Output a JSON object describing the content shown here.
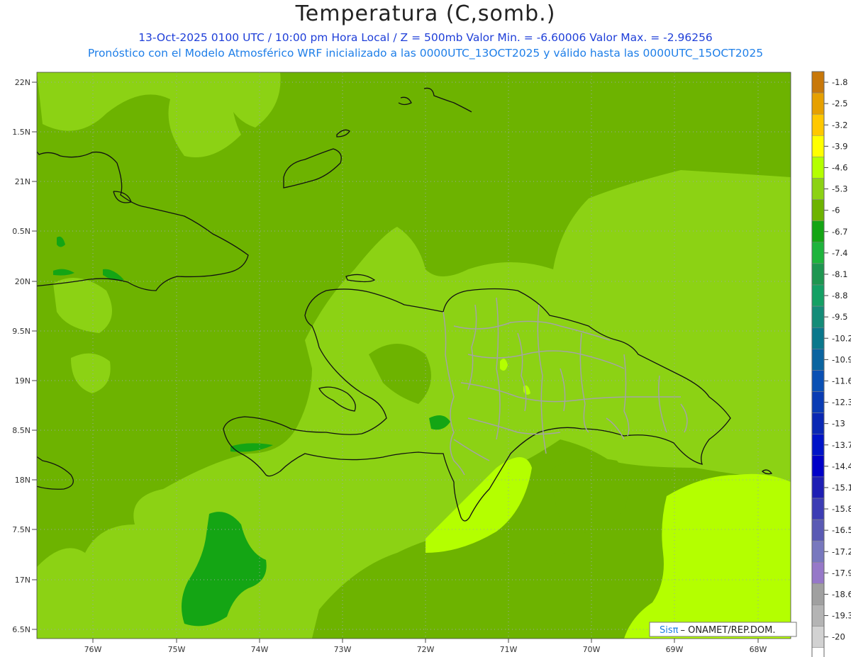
{
  "header": {
    "title": "Temperatura (C,somb.)",
    "subtitle_1": "13-Oct-2025  0100 UTC / 10:00 pm Hora Local / Z = 500mb  Valor Min. = -6.60006  Valor Max. = -2.96256",
    "subtitle_2": "Pronóstico con el Modelo Atmosférico WRF inicializado a las 0000UTC_13OCT2025 y válido hasta las  0000UTC_15OCT2025"
  },
  "map": {
    "lat_labels": [
      "22N",
      "1.5N",
      "21N",
      "0.5N",
      "20N",
      "9.5N",
      "19N",
      "8.5N",
      "18N",
      "7.5N",
      "17N",
      "6.5N"
    ],
    "lon_labels": [
      "76W",
      "75W",
      "74W",
      "73W",
      "72W",
      "71W",
      "70W",
      "69W",
      "68W"
    ],
    "background_color": "#6db300",
    "grid": "dotted"
  },
  "colorbar": {
    "entries": [
      {
        "label": "-1.8",
        "color": "#c8780a"
      },
      {
        "label": "-2.5",
        "color": "#e6a000"
      },
      {
        "label": "-3.2",
        "color": "#ffc800"
      },
      {
        "label": "-3.9",
        "color": "#ffff00"
      },
      {
        "label": "-4.6",
        "color": "#b4ff00"
      },
      {
        "label": "-5.3",
        "color": "#8cd214"
      },
      {
        "label": "-6",
        "color": "#6db300"
      },
      {
        "label": "-6.7",
        "color": "#14a514"
      },
      {
        "label": "-7.4",
        "color": "#1eb43c"
      },
      {
        "label": "-8.1",
        "color": "#1e9650"
      },
      {
        "label": "-8.8",
        "color": "#14a064"
      },
      {
        "label": "-9.5",
        "color": "#148c78"
      },
      {
        "label": "-10.2",
        "color": "#0a788c"
      },
      {
        "label": "-10.9",
        "color": "#0a64a0"
      },
      {
        "label": "-11.6",
        "color": "#0a50b4"
      },
      {
        "label": "-12.3",
        "color": "#0a3cb4"
      },
      {
        "label": "-13",
        "color": "#0a28b4"
      },
      {
        "label": "-13.7",
        "color": "#0014c8"
      },
      {
        "label": "-14.4",
        "color": "#0000c8"
      },
      {
        "label": "-15.1",
        "color": "#1e1eb4"
      },
      {
        "label": "-15.8",
        "color": "#3c3cb4"
      },
      {
        "label": "-16.5",
        "color": "#5a5ab4"
      },
      {
        "label": "-17.2",
        "color": "#7878be"
      },
      {
        "label": "-17.9",
        "color": "#9678c8"
      },
      {
        "label": "-18.6",
        "color": "#a0a0a0"
      },
      {
        "label": "-19.3",
        "color": "#b4b4b4"
      },
      {
        "label": "-20",
        "color": "#d2d2d2"
      },
      {
        "label": "",
        "color": "#ffffff"
      }
    ]
  },
  "credit": {
    "brand": "Sis",
    "pi": "π",
    "text": "– ONAMET/REP.DOM."
  }
}
